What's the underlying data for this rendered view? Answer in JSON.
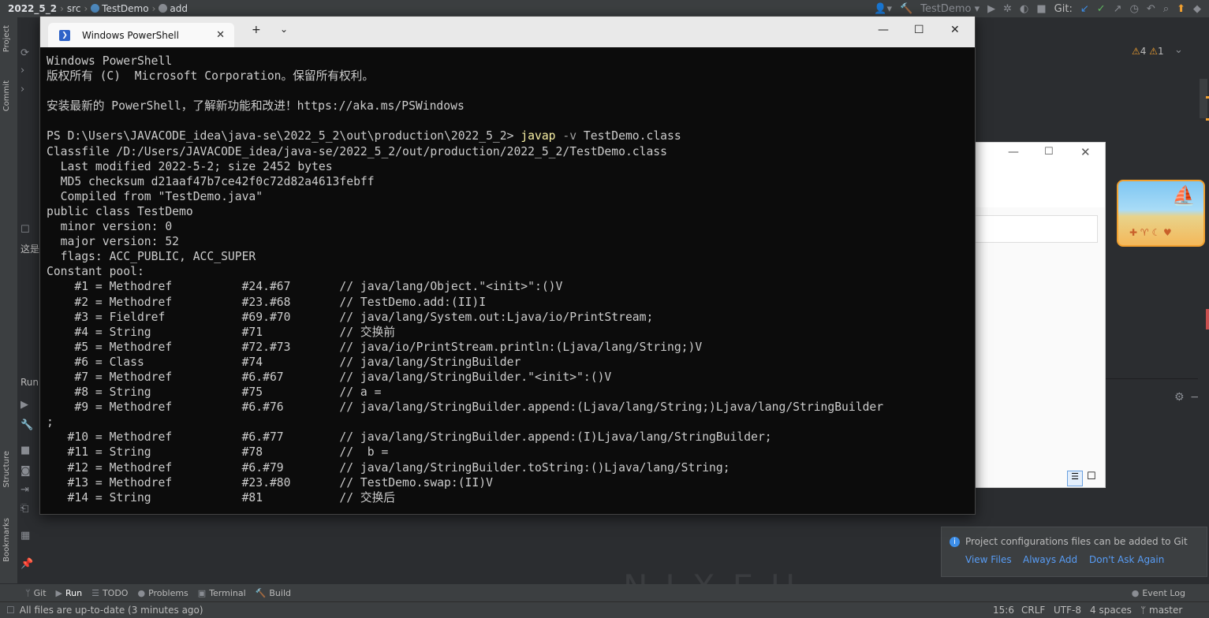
{
  "ide": {
    "breadcrumb": [
      "2022_5_2",
      "src",
      "TestDemo",
      "add"
    ],
    "run_config": "TestDemo",
    "git_label": "Git:",
    "warnings": "4",
    "weak_warnings": "1",
    "left_tabs": [
      "Project",
      "Commit",
      "Structure",
      "Bookmarks"
    ],
    "left_panel_text": "这是",
    "run_label": "Run",
    "bottom_tools": [
      "Git",
      "Run",
      "TODO",
      "Problems",
      "Terminal",
      "Build"
    ],
    "event_log": "Event Log",
    "status_left": "All files are up-to-date (3 minutes ago)",
    "status_right": {
      "position": "15:6",
      "line_sep": "CRLF",
      "encoding": "UTF-8",
      "indent": "4 spaces",
      "branch": "master"
    },
    "watermark": "NIXEU"
  },
  "notification": {
    "message": "Project configurations files can be added to Git",
    "actions": [
      "View Files",
      "Always Add",
      "Don't Ask Again"
    ]
  },
  "powershell": {
    "tab_title": "Windows PowerShell",
    "prompt": "PS D:\\Users\\JAVACODE_idea\\java-se\\2022_5_2\\out\\production\\2022_5_2> ",
    "command": "javap",
    "command_args": " -v ",
    "command_target": "TestDemo.class",
    "lines_before": [
      "Windows PowerShell",
      "版权所有 (C)  Microsoft Corporation。保留所有权利。",
      "",
      "安装最新的 PowerShell，了解新功能和改进！https://aka.ms/PSWindows",
      ""
    ],
    "lines_after": [
      "Classfile /D:/Users/JAVACODE_idea/java-se/2022_5_2/out/production/2022_5_2/TestDemo.class",
      "  Last modified 2022-5-2; size 2452 bytes",
      "  MD5 checksum d21aaf47b7ce42f0c72d82a4613febff",
      "  Compiled from \"TestDemo.java\"",
      "public class TestDemo",
      "  minor version: 0",
      "  major version: 52",
      "  flags: ACC_PUBLIC, ACC_SUPER",
      "Constant pool:",
      "    #1 = Methodref          #24.#67       // java/lang/Object.\"<init>\":()V",
      "    #2 = Methodref          #23.#68       // TestDemo.add:(II)I",
      "    #3 = Fieldref           #69.#70       // java/lang/System.out:Ljava/io/PrintStream;",
      "    #4 = String             #71           // 交换前",
      "    #5 = Methodref          #72.#73       // java/io/PrintStream.println:(Ljava/lang/String;)V",
      "    #6 = Class              #74           // java/lang/StringBuilder",
      "    #7 = Methodref          #6.#67        // java/lang/StringBuilder.\"<init>\":()V",
      "    #8 = String             #75           // a =",
      "    #9 = Methodref          #6.#76        // java/lang/StringBuilder.append:(Ljava/lang/String;)Ljava/lang/StringBuilder",
      ";",
      "   #10 = Methodref          #6.#77        // java/lang/StringBuilder.append:(I)Ljava/lang/StringBuilder;",
      "   #11 = String             #78           //  b =",
      "   #12 = Methodref          #6.#79        // java/lang/StringBuilder.toString:()Ljava/lang/String;",
      "   #13 = Methodref          #23.#80       // TestDemo.swap:(II)V",
      "   #14 = String             #81           // 交换后"
    ]
  }
}
